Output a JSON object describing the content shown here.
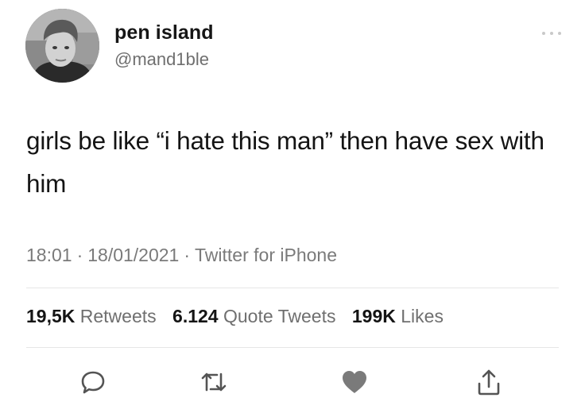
{
  "user": {
    "display_name": "pen island",
    "handle": "@mand1ble"
  },
  "tweet": {
    "text": "girls be like “i hate this man” then have sex with him",
    "time": "18:01",
    "date": "18/01/2021",
    "source": "Twitter for iPhone",
    "separator": "·"
  },
  "stats": {
    "retweets_count": "19,5K",
    "retweets_label": "Retweets",
    "quotes_count": "6.124",
    "quotes_label": "Quote Tweets",
    "likes_count": "199K",
    "likes_label": "Likes"
  },
  "actions": {
    "reply_icon": "speech-bubble-icon",
    "retweet_icon": "retweet-arrows-icon",
    "like_icon": "filled-heart-icon",
    "share_icon": "share-upload-icon",
    "liked": true
  },
  "colors": {
    "name": "#161616",
    "secondary_text": "#6f6f6f",
    "divider": "#e6e6e6",
    "icon": "#545454",
    "liked_heart": "#7a7a7a"
  }
}
